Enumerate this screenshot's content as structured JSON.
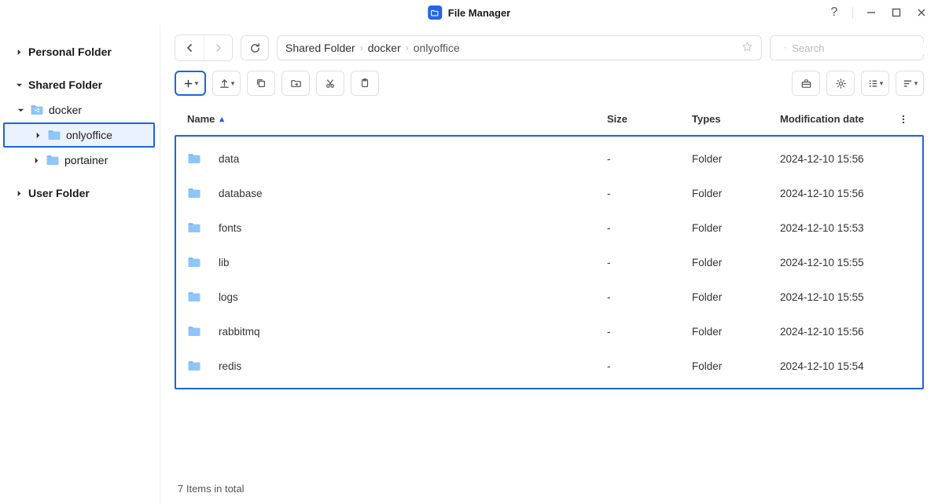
{
  "app": {
    "title": "File Manager"
  },
  "sidebar": {
    "nodes": [
      {
        "label": "Personal Folder",
        "level": 0,
        "expanded": false,
        "icon": false,
        "selected": false,
        "caret": "right"
      },
      {
        "label": "Shared Folder",
        "level": 0,
        "expanded": true,
        "icon": false,
        "selected": false,
        "caret": "down"
      },
      {
        "label": "docker",
        "level": 1,
        "expanded": true,
        "icon": true,
        "selected": false,
        "caret": "down"
      },
      {
        "label": "onlyoffice",
        "level": 2,
        "expanded": false,
        "icon": true,
        "selected": true,
        "caret": "right"
      },
      {
        "label": "portainer",
        "level": 2,
        "expanded": false,
        "icon": true,
        "selected": false,
        "caret": "right"
      },
      {
        "label": "User Folder",
        "level": 0,
        "expanded": false,
        "icon": false,
        "selected": false,
        "caret": "right"
      }
    ]
  },
  "breadcrumb": [
    "Shared Folder",
    "docker",
    "onlyoffice"
  ],
  "search": {
    "placeholder": "Search"
  },
  "columns": {
    "name": "Name",
    "size": "Size",
    "types": "Types",
    "date": "Modification date"
  },
  "rows": [
    {
      "name": "data",
      "size": "-",
      "types": "Folder",
      "date": "2024-12-10 15:56"
    },
    {
      "name": "database",
      "size": "-",
      "types": "Folder",
      "date": "2024-12-10 15:56"
    },
    {
      "name": "fonts",
      "size": "-",
      "types": "Folder",
      "date": "2024-12-10 15:53"
    },
    {
      "name": "lib",
      "size": "-",
      "types": "Folder",
      "date": "2024-12-10 15:55"
    },
    {
      "name": "logs",
      "size": "-",
      "types": "Folder",
      "date": "2024-12-10 15:55"
    },
    {
      "name": "rabbitmq",
      "size": "-",
      "types": "Folder",
      "date": "2024-12-10 15:56"
    },
    {
      "name": "redis",
      "size": "-",
      "types": "Folder",
      "date": "2024-12-10 15:54"
    }
  ],
  "footer": "7 Items in total"
}
